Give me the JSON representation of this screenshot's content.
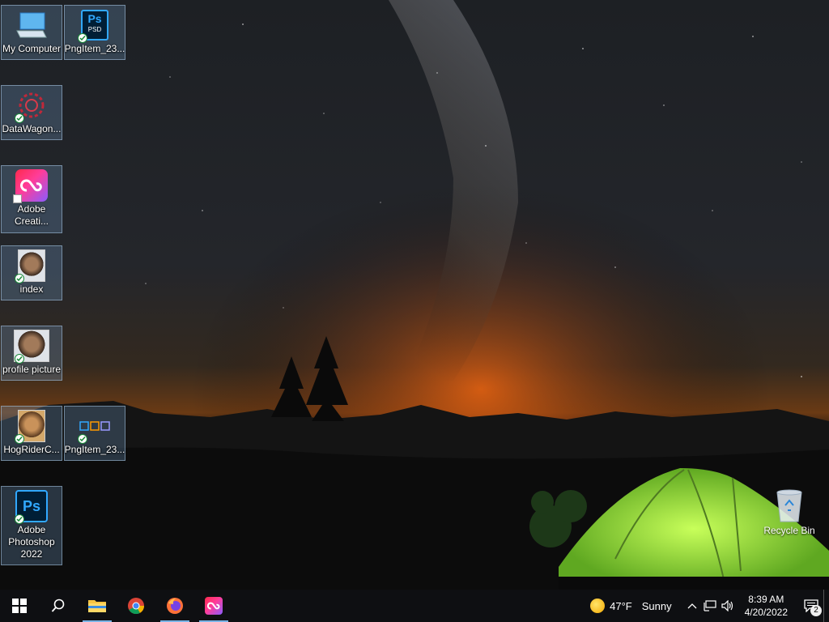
{
  "desktop": {
    "icons": [
      {
        "label": "My Computer"
      },
      {
        "label": "PngItem_23..."
      },
      {
        "label": "DataWagon..."
      },
      {
        "label": "Adobe Creati..."
      },
      {
        "label": "index"
      },
      {
        "label": "profile picture"
      },
      {
        "label": "HogRiderC..."
      },
      {
        "label": "PngItem_23..."
      },
      {
        "label": "Adobe Photoshop 2022"
      }
    ],
    "recycle_bin": {
      "label": "Recycle Bin"
    },
    "psd_badge": "PSD",
    "ps_text": "Ps"
  },
  "taskbar": {
    "weather": {
      "temp": "47°F",
      "condition": "Sunny"
    },
    "clock": {
      "time": "8:39 AM",
      "date": "4/20/2022"
    },
    "notifications": "2"
  },
  "colors": {
    "taskbar_bg": "#0e0f12",
    "running_indicator": "#79b4e6",
    "icon_selection": "#6e96be"
  }
}
